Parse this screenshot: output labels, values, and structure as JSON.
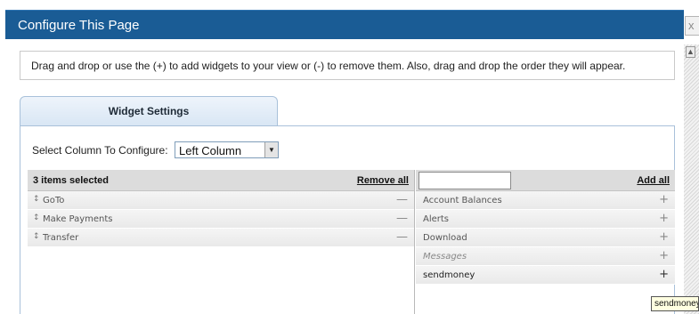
{
  "dialog": {
    "title": "Configure This Page",
    "close_glyph": "x"
  },
  "instructions": "Drag and drop or use the (+) to add widgets to your view or (-) to remove them. Also, drag and drop the order they will appear.",
  "tab": {
    "label": "Widget Settings"
  },
  "column_select": {
    "label": "Select Column To Configure:",
    "value": "Left Column"
  },
  "selected_list": {
    "count_label": "3 items selected",
    "remove_all_label": "Remove all",
    "items": [
      {
        "label": "GoTo",
        "action": "—"
      },
      {
        "label": "Make Payments",
        "action": "—"
      },
      {
        "label": "Transfer",
        "action": "—"
      }
    ]
  },
  "available_list": {
    "filter_value": "",
    "add_all_label": "Add all",
    "items": [
      {
        "label": "Account Balances",
        "action": "+"
      },
      {
        "label": "Alerts",
        "action": "+"
      },
      {
        "label": "Download",
        "action": "+"
      },
      {
        "label": "Messages",
        "action": "+"
      },
      {
        "label": "sendmoney",
        "action": "+"
      }
    ]
  },
  "tooltip": {
    "text": "sendmoney"
  },
  "colors": {
    "title_bar": "#1a5c95",
    "tab_border": "#a9c1da",
    "list_header": "#dcdcdc"
  },
  "icons": {
    "drag_handle": "drag-handle-icon",
    "remove": "minus-icon",
    "add": "plus-icon",
    "dropdown": "chevron-down-icon",
    "close": "close-icon"
  }
}
